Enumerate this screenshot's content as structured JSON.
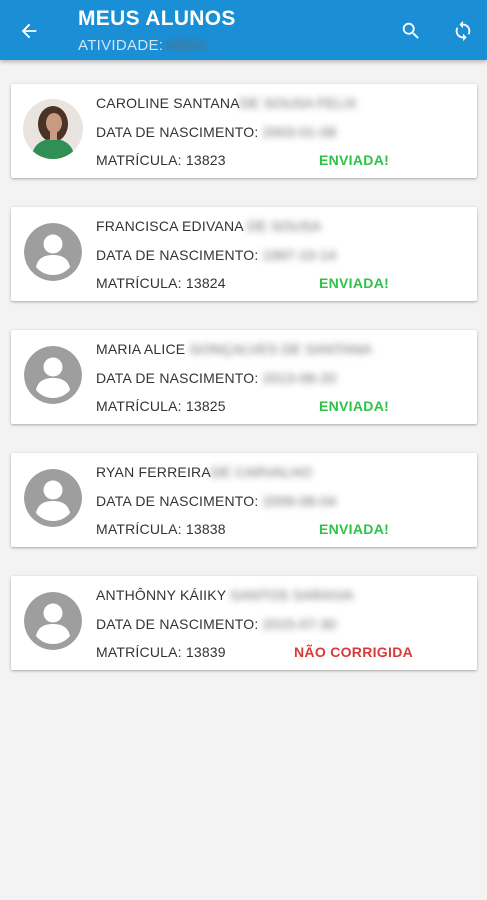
{
  "header": {
    "title": "MEUS ALUNOS",
    "subtitle_label": "ATIVIDADE:",
    "subtitle_value": "ABSA"
  },
  "labels": {
    "birth": "DATA DE NASCIMENTO:",
    "matricula": "MATRÍCULA:"
  },
  "students": [
    {
      "name": "CAROLINE SANTANA",
      "name_rest": "DE SOUSA FELIX",
      "birth": "2003-01-08",
      "matricula": "13823",
      "status": "ENVIADA!"
    },
    {
      "name": "FRANCISCA EDIVANA",
      "name_rest": "DE SOUSA",
      "birth": "1997-10-14",
      "matricula": "13824",
      "status": "ENVIADA!"
    },
    {
      "name": "MARIA ALICE",
      "name_rest": "GONÇALVES DE SANTANA",
      "birth": "2013-08-20",
      "matricula": "13825",
      "status": "ENVIADA!"
    },
    {
      "name": "RYAN FERREIRA",
      "name_rest": "DE CARVALHO",
      "birth": "2009-08-04",
      "matricula": "13838",
      "status": "ENVIADA!"
    },
    {
      "name": "ANTHÔNNY KÁIIKY",
      "name_rest": "SANTOS SARAIVA",
      "birth": "2015-07-30",
      "matricula": "13839",
      "status": "NÃO CORRIGIDA"
    }
  ],
  "colors": {
    "appbar": "#1a8fd6",
    "sent": "#2fc24a",
    "not_corrected": "#d83a3a"
  },
  "icons": {
    "back": "arrow-back-icon",
    "search": "search-icon",
    "refresh": "refresh-icon",
    "avatar": "person-icon"
  }
}
